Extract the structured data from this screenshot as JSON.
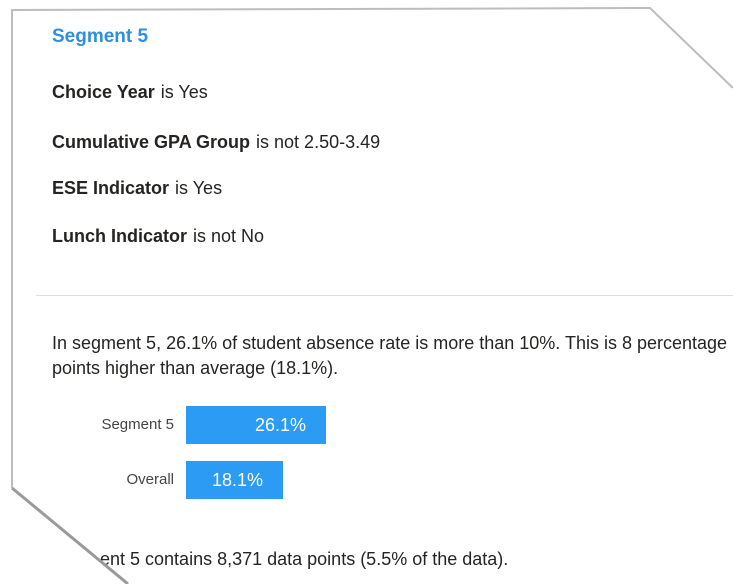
{
  "segment": {
    "title": "Segment 5",
    "conditions": [
      {
        "field": "Choice Year",
        "operator": "is Yes"
      },
      {
        "field": "Cumulative GPA Group",
        "operator": "is not 2.50-3.49"
      },
      {
        "field": "ESE Indicator",
        "operator": "is Yes"
      },
      {
        "field": "Lunch Indicator",
        "operator": "is not No"
      }
    ]
  },
  "summary": {
    "text": "In segment 5, 26.1% of student absence rate is more than 10%. This is 8 percentage points higher than average (18.1%)."
  },
  "comparison": {
    "bars": [
      {
        "label": "Segment 5",
        "value_text": "26.1%",
        "value": 26.1
      },
      {
        "label": "Overall",
        "value_text": "18.1%",
        "value": 18.1
      }
    ],
    "bar_color": "#2b9bf4"
  },
  "footer": {
    "text": "ent 5 contains 8,371 data points (5.5% of the data)."
  },
  "colors": {
    "title": "#2f8fdc",
    "text": "#252423"
  }
}
